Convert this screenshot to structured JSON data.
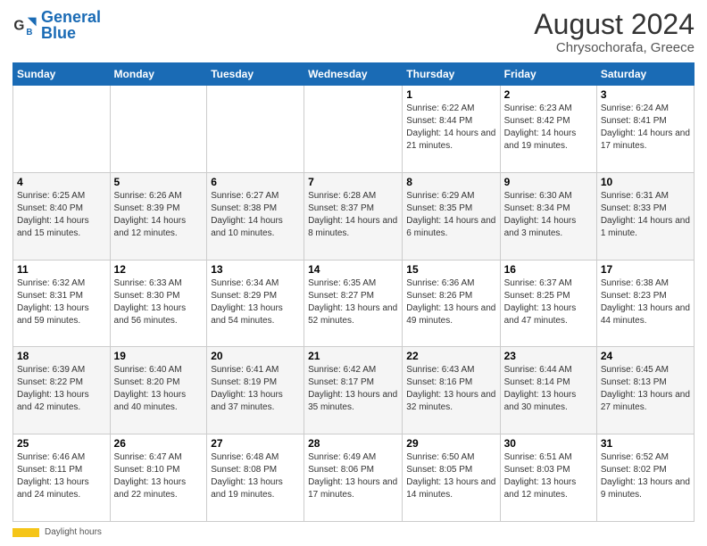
{
  "logo": {
    "text_general": "General",
    "text_blue": "Blue"
  },
  "header": {
    "title": "August 2024",
    "subtitle": "Chrysochorafa, Greece"
  },
  "weekdays": [
    "Sunday",
    "Monday",
    "Tuesday",
    "Wednesday",
    "Thursday",
    "Friday",
    "Saturday"
  ],
  "weeks": [
    [
      {
        "day": "",
        "info": ""
      },
      {
        "day": "",
        "info": ""
      },
      {
        "day": "",
        "info": ""
      },
      {
        "day": "",
        "info": ""
      },
      {
        "day": "1",
        "info": "Sunrise: 6:22 AM\nSunset: 8:44 PM\nDaylight: 14 hours and 21 minutes."
      },
      {
        "day": "2",
        "info": "Sunrise: 6:23 AM\nSunset: 8:42 PM\nDaylight: 14 hours and 19 minutes."
      },
      {
        "day": "3",
        "info": "Sunrise: 6:24 AM\nSunset: 8:41 PM\nDaylight: 14 hours and 17 minutes."
      }
    ],
    [
      {
        "day": "4",
        "info": "Sunrise: 6:25 AM\nSunset: 8:40 PM\nDaylight: 14 hours and 15 minutes."
      },
      {
        "day": "5",
        "info": "Sunrise: 6:26 AM\nSunset: 8:39 PM\nDaylight: 14 hours and 12 minutes."
      },
      {
        "day": "6",
        "info": "Sunrise: 6:27 AM\nSunset: 8:38 PM\nDaylight: 14 hours and 10 minutes."
      },
      {
        "day": "7",
        "info": "Sunrise: 6:28 AM\nSunset: 8:37 PM\nDaylight: 14 hours and 8 minutes."
      },
      {
        "day": "8",
        "info": "Sunrise: 6:29 AM\nSunset: 8:35 PM\nDaylight: 14 hours and 6 minutes."
      },
      {
        "day": "9",
        "info": "Sunrise: 6:30 AM\nSunset: 8:34 PM\nDaylight: 14 hours and 3 minutes."
      },
      {
        "day": "10",
        "info": "Sunrise: 6:31 AM\nSunset: 8:33 PM\nDaylight: 14 hours and 1 minute."
      }
    ],
    [
      {
        "day": "11",
        "info": "Sunrise: 6:32 AM\nSunset: 8:31 PM\nDaylight: 13 hours and 59 minutes."
      },
      {
        "day": "12",
        "info": "Sunrise: 6:33 AM\nSunset: 8:30 PM\nDaylight: 13 hours and 56 minutes."
      },
      {
        "day": "13",
        "info": "Sunrise: 6:34 AM\nSunset: 8:29 PM\nDaylight: 13 hours and 54 minutes."
      },
      {
        "day": "14",
        "info": "Sunrise: 6:35 AM\nSunset: 8:27 PM\nDaylight: 13 hours and 52 minutes."
      },
      {
        "day": "15",
        "info": "Sunrise: 6:36 AM\nSunset: 8:26 PM\nDaylight: 13 hours and 49 minutes."
      },
      {
        "day": "16",
        "info": "Sunrise: 6:37 AM\nSunset: 8:25 PM\nDaylight: 13 hours and 47 minutes."
      },
      {
        "day": "17",
        "info": "Sunrise: 6:38 AM\nSunset: 8:23 PM\nDaylight: 13 hours and 44 minutes."
      }
    ],
    [
      {
        "day": "18",
        "info": "Sunrise: 6:39 AM\nSunset: 8:22 PM\nDaylight: 13 hours and 42 minutes."
      },
      {
        "day": "19",
        "info": "Sunrise: 6:40 AM\nSunset: 8:20 PM\nDaylight: 13 hours and 40 minutes."
      },
      {
        "day": "20",
        "info": "Sunrise: 6:41 AM\nSunset: 8:19 PM\nDaylight: 13 hours and 37 minutes."
      },
      {
        "day": "21",
        "info": "Sunrise: 6:42 AM\nSunset: 8:17 PM\nDaylight: 13 hours and 35 minutes."
      },
      {
        "day": "22",
        "info": "Sunrise: 6:43 AM\nSunset: 8:16 PM\nDaylight: 13 hours and 32 minutes."
      },
      {
        "day": "23",
        "info": "Sunrise: 6:44 AM\nSunset: 8:14 PM\nDaylight: 13 hours and 30 minutes."
      },
      {
        "day": "24",
        "info": "Sunrise: 6:45 AM\nSunset: 8:13 PM\nDaylight: 13 hours and 27 minutes."
      }
    ],
    [
      {
        "day": "25",
        "info": "Sunrise: 6:46 AM\nSunset: 8:11 PM\nDaylight: 13 hours and 24 minutes."
      },
      {
        "day": "26",
        "info": "Sunrise: 6:47 AM\nSunset: 8:10 PM\nDaylight: 13 hours and 22 minutes."
      },
      {
        "day": "27",
        "info": "Sunrise: 6:48 AM\nSunset: 8:08 PM\nDaylight: 13 hours and 19 minutes."
      },
      {
        "day": "28",
        "info": "Sunrise: 6:49 AM\nSunset: 8:06 PM\nDaylight: 13 hours and 17 minutes."
      },
      {
        "day": "29",
        "info": "Sunrise: 6:50 AM\nSunset: 8:05 PM\nDaylight: 13 hours and 14 minutes."
      },
      {
        "day": "30",
        "info": "Sunrise: 6:51 AM\nSunset: 8:03 PM\nDaylight: 13 hours and 12 minutes."
      },
      {
        "day": "31",
        "info": "Sunrise: 6:52 AM\nSunset: 8:02 PM\nDaylight: 13 hours and 9 minutes."
      }
    ]
  ],
  "footer": {
    "daylight_label": "Daylight hours"
  }
}
